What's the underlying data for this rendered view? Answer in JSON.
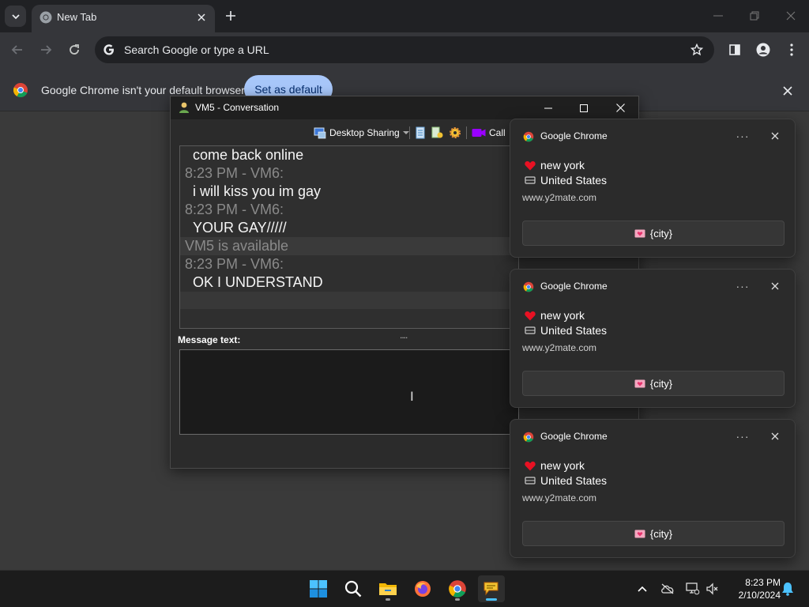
{
  "browser": {
    "tab_title": "New Tab",
    "omnibox_placeholder": "Search Google or type a URL",
    "infobar": {
      "text": "Google Chrome isn't your default browser",
      "button": "Set as default"
    }
  },
  "conversation": {
    "title": "VM5 - Conversation",
    "toolbar": {
      "desktop_sharing": "Desktop Sharing",
      "call": "Call"
    },
    "messages": [
      {
        "kind": "msg",
        "text": "come back online"
      },
      {
        "kind": "time",
        "text": "8:23 PM - VM6:"
      },
      {
        "kind": "msg",
        "text": "i will kiss you im gay"
      },
      {
        "kind": "time",
        "text": "8:23 PM - VM6:"
      },
      {
        "kind": "msg",
        "text": "YOUR GAY/////"
      },
      {
        "kind": "status",
        "text": "VM5 is available"
      },
      {
        "kind": "time",
        "text": "8:23 PM - VM6:"
      },
      {
        "kind": "msg",
        "text": "OK I UNDERSTAND"
      }
    ],
    "splitter": "....",
    "message_label": "Message text:"
  },
  "notifications": [
    {
      "app": "Google Chrome",
      "more": "···",
      "line1": "new york",
      "line2": "United States",
      "url": "www.y2mate.com",
      "button": "{city}"
    },
    {
      "app": "Google Chrome",
      "more": "···",
      "line1": "new york",
      "line2": "United States",
      "url": "www.y2mate.com",
      "button": "{city}"
    },
    {
      "app": "Google Chrome",
      "more": "···",
      "line1": "new york",
      "line2": "United States",
      "url": "www.y2mate.com",
      "button": "{city}"
    }
  ],
  "taskbar": {
    "apps": [
      "start-icon",
      "search-icon",
      "file-explorer-icon",
      "firefox-icon",
      "chrome-icon",
      "messenger-icon"
    ],
    "time": "8:23 PM",
    "date": "2/10/2024"
  },
  "colors": {
    "accent": "#a8c7fa",
    "taskbar_active": "#4cc2ff",
    "heart": "#e81123"
  }
}
